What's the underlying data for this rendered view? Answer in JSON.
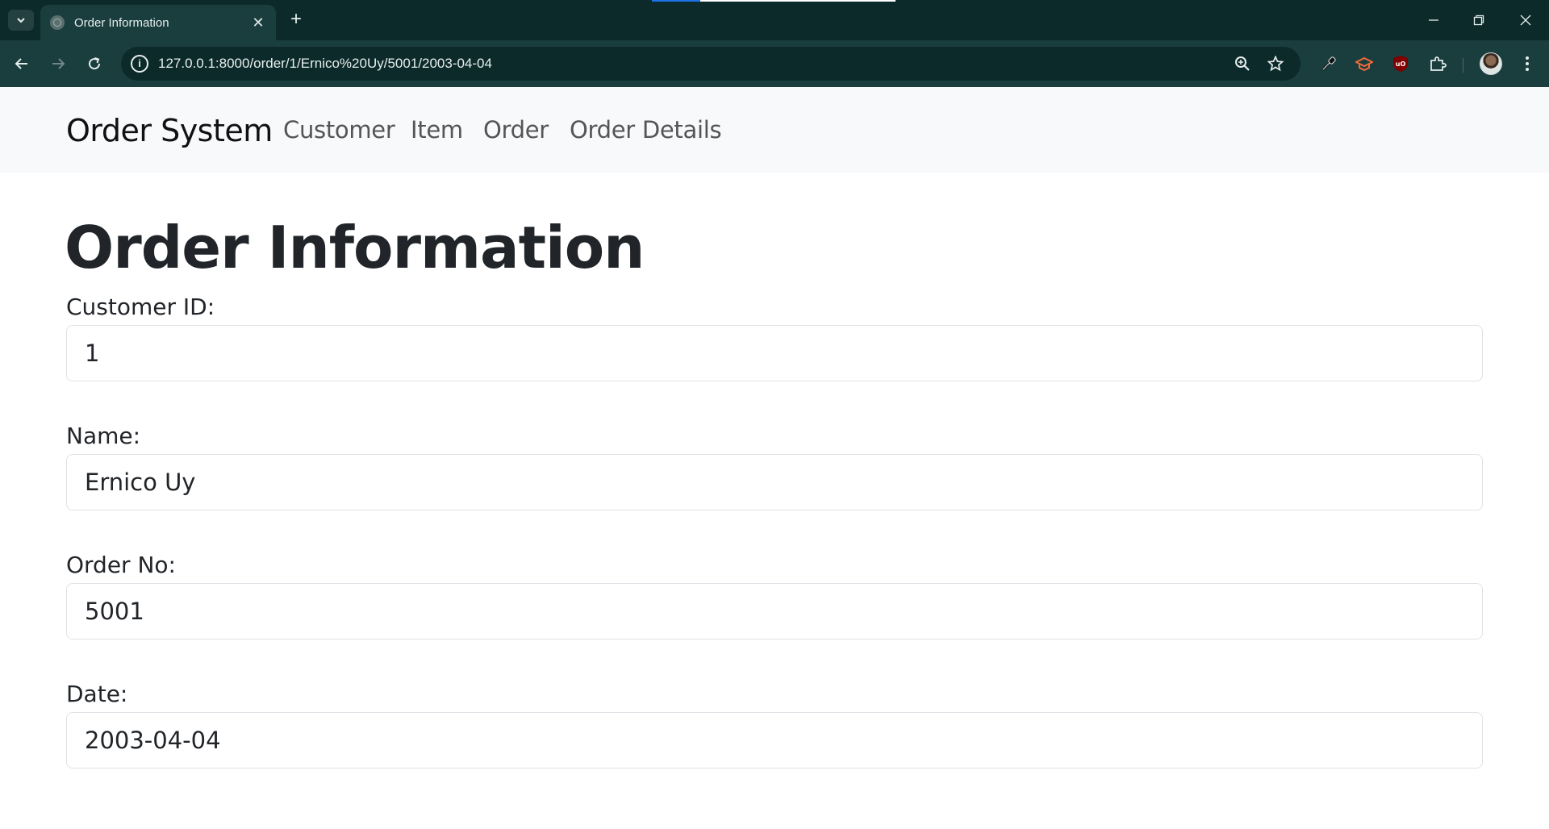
{
  "browser": {
    "tab_title": "Order Information",
    "tab_close": "✕",
    "new_tab": "+",
    "url": "127.0.0.1:8000/order/1/Ernico%20Uy/5001/2003-04-04"
  },
  "navbar": {
    "brand": "Order System",
    "links": [
      "Customer",
      "Item",
      "Order",
      "Order Details"
    ]
  },
  "main": {
    "title": "Order Information",
    "fields": [
      {
        "label": "Customer ID:",
        "value": "1"
      },
      {
        "label": "Name:",
        "value": "Ernico Uy"
      },
      {
        "label": "Order No:",
        "value": "5001"
      },
      {
        "label": "Date:",
        "value": "2003-04-04"
      }
    ]
  },
  "colors": {
    "chrome_dark": "#0d2a2a",
    "chrome_toolbar": "#1a3d3d",
    "navbar_bg": "#f8f9fa",
    "text": "#212529"
  }
}
